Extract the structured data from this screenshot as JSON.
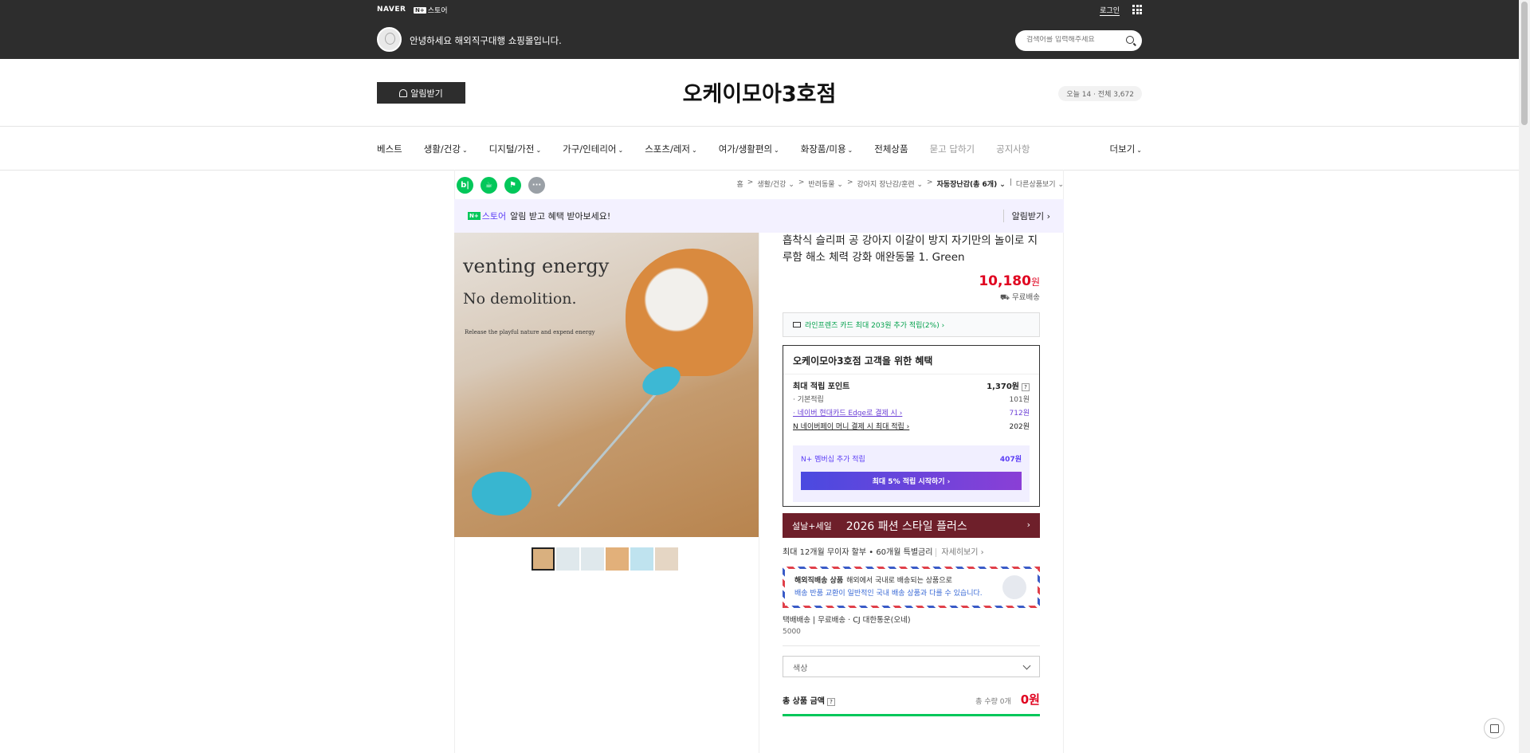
{
  "topbar": {
    "naver": "NAVER",
    "nstore_badge": "N+",
    "nstore_label": "스토어",
    "login": "로그인",
    "welcome": "안녕하세요 해외직구대행 쇼핑몰입니다.",
    "search_placeholder": "검색어를 입력해주세요"
  },
  "store": {
    "notify_label": "알림받기",
    "title": "오케이모아3호점",
    "visits": "오늘 14 · 전체 3,672"
  },
  "categories": [
    {
      "label": "베스트",
      "chev": ""
    },
    {
      "label": "생활/건강",
      "chev": "⌄"
    },
    {
      "label": "디지털/가전",
      "chev": "⌄"
    },
    {
      "label": "가구/인테리어",
      "chev": "⌄"
    },
    {
      "label": "스포츠/레저",
      "chev": "⌄"
    },
    {
      "label": "여가/생활편의",
      "chev": "⌄"
    },
    {
      "label": "화장품/미용",
      "chev": "⌄"
    },
    {
      "label": "전체상품",
      "chev": ""
    },
    {
      "label": "묻고 답하기",
      "chev": ""
    },
    {
      "label": "공지사항",
      "chev": ""
    }
  ],
  "more_label": "더보기",
  "breadcrumbs": [
    "홈",
    ">",
    "생활/건강 ⌄",
    ">",
    "반려동물 ⌄",
    ">",
    "강아지 장난감/훈련 ⌄",
    ">",
    "자동장난감(총 6개) ⌄",
    "|",
    "다른상품보기 ⌄"
  ],
  "share_buttons": [
    "b|",
    "☕",
    "⚑",
    "···"
  ],
  "store_banner": {
    "badge": "N+",
    "store_word": "스토어",
    "text": "알림 받고 혜택 받아보세요!",
    "action": "알림받기 ›"
  },
  "image_text": {
    "line1": "venting energy",
    "line2": "No demolition.",
    "line3": "Release the playful nature and expend energy"
  },
  "product": {
    "title": "흡착식 슬리퍼 공 강아지 이갈이 방지 자기만의 놀이로 지루함 해소 체력 강화 애완동물 1. Green",
    "price": "10,180",
    "price_unit": "원",
    "shipping": "무료배송",
    "card_benefit": "라인프렌즈 카드 최대 203원 추가 적립(2%) ›"
  },
  "benefit": {
    "header": "오케이모아3호점 고객을 위한 혜택",
    "max_label": "최대 적립 포인트",
    "max_value": "1,370원",
    "q": "?",
    "rows": [
      {
        "label": "· 기본적립",
        "value": "101원"
      },
      {
        "label": "· 네이버 현대카드 Edge로 결제 시 ›",
        "value": "712원"
      },
      {
        "label": "N 네이버페이 머니 결제 시 최대 적립 ›",
        "value": "202원"
      }
    ],
    "membership_label": "N+ 멤버십 추가 적립",
    "membership_value": "407원",
    "membership_btn": "최대 5% 적립 시작하기 ›"
  },
  "sale": {
    "tag": "설날+세일",
    "title": "2026 패션 스타일 플러스",
    "arrow": "›"
  },
  "installment": {
    "text": "최대 12개월 무이자 할부 • 60개월 특별금리",
    "link": "자세히보기 ›"
  },
  "overseas": {
    "label": "해외직배송 상품",
    "desc": "해외에서 국내로 배송되는 상품으로",
    "note": "배송 반품 교환이 일반적인 국내 배송 상품과 다를 수 있습니다."
  },
  "delivery": {
    "line": "택배배송  |  무료배송 · CJ 대한통운(오네)",
    "sub": "5000"
  },
  "option": {
    "placeholder": "색상"
  },
  "total": {
    "label": "총 상품 금액",
    "q": "?",
    "qty": "총 수량 0개",
    "amount": "0원"
  }
}
